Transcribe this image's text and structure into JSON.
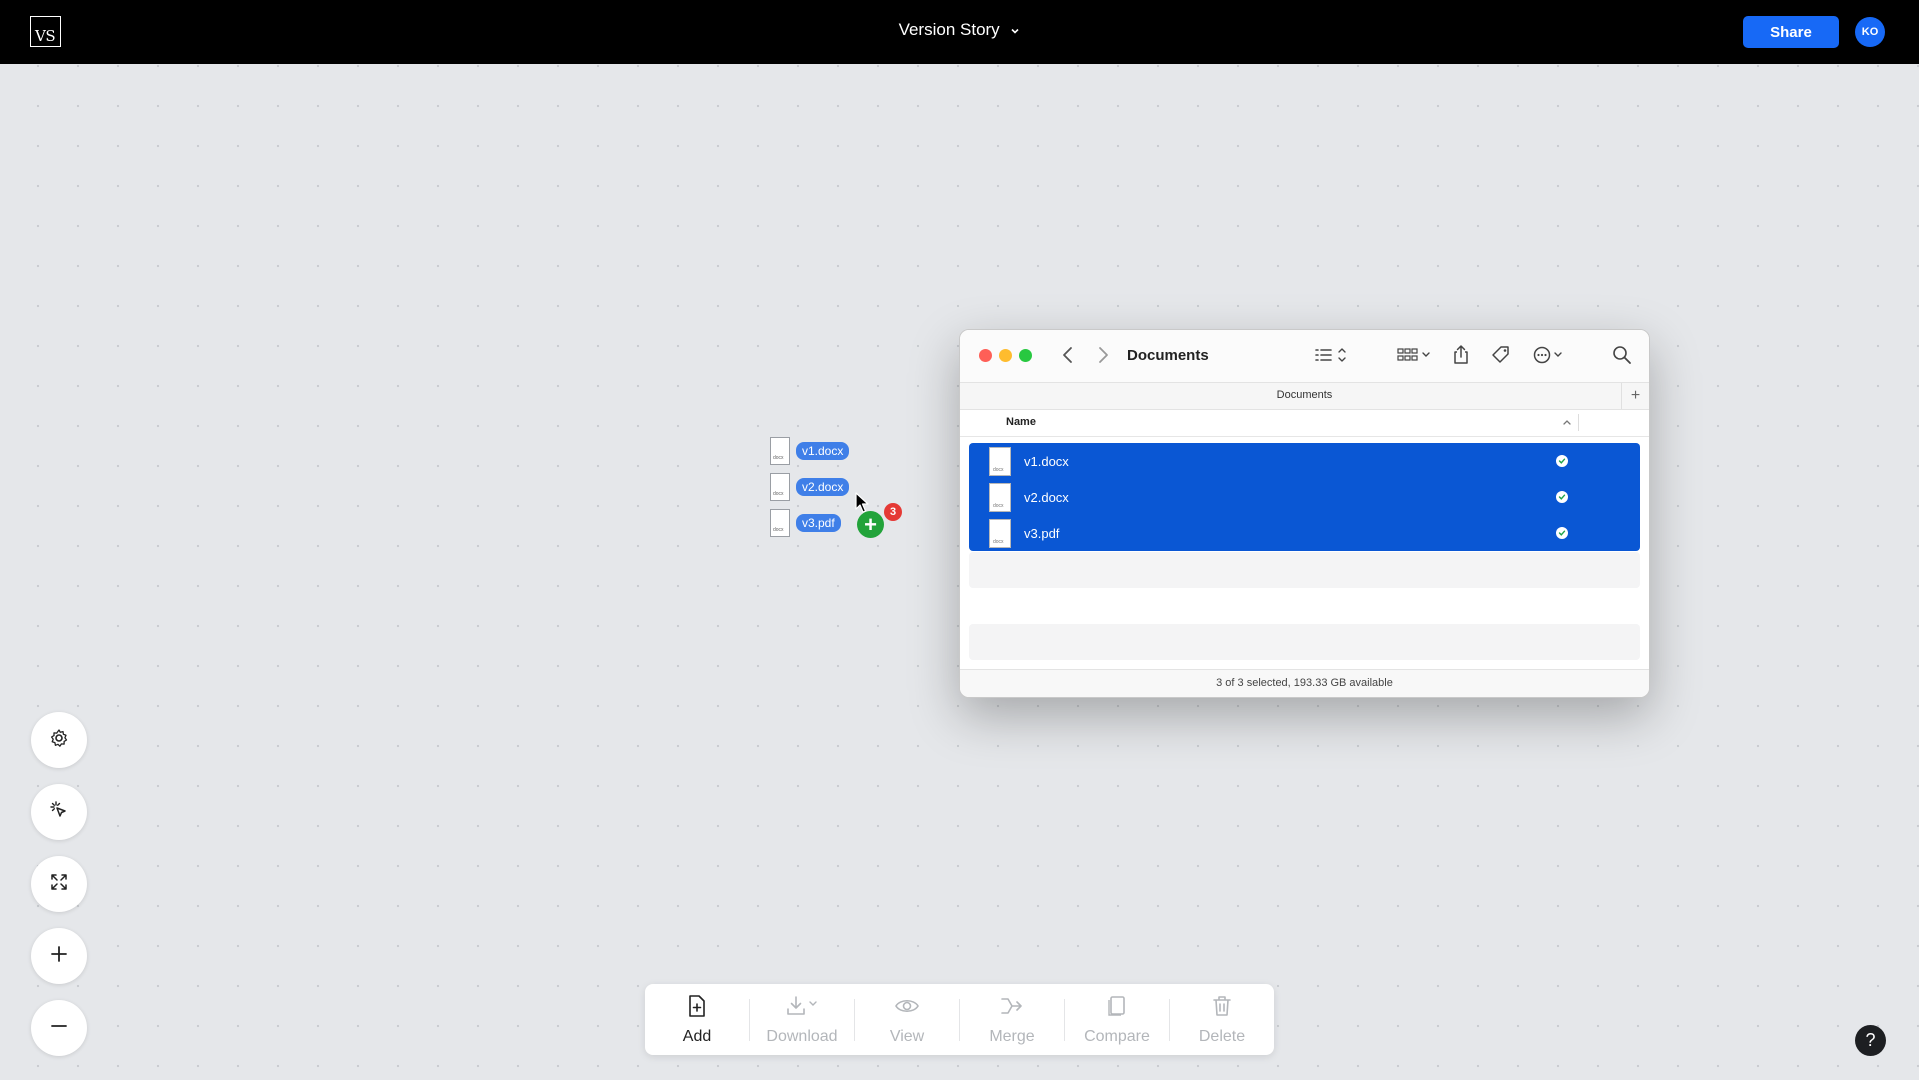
{
  "app": {
    "logo_text": "VS",
    "title": "Version Story",
    "share_label": "Share",
    "avatar_initials": "KO",
    "brand_color": "#1769f6"
  },
  "canvas_tools": {
    "settings": "gear-icon",
    "select": "magic-select-icon",
    "fit": "expand-icon",
    "zoom_in": "plus-icon",
    "zoom_out": "minus-icon"
  },
  "drag": {
    "files": [
      "v1.docx",
      "v2.docx",
      "v3.pdf"
    ],
    "count": "3"
  },
  "finder": {
    "title": "Documents",
    "path_label": "Documents",
    "column_name": "Name",
    "files": [
      {
        "name": "v1.docx"
      },
      {
        "name": "v2.docx"
      },
      {
        "name": "v3.pdf"
      }
    ],
    "status": "3 of 3 selected, 193.33 GB available",
    "selection_color": "#0a57d4"
  },
  "toolbar": {
    "add": "Add",
    "download": "Download",
    "view": "View",
    "merge": "Merge",
    "compare": "Compare",
    "delete": "Delete"
  },
  "help_label": "?"
}
